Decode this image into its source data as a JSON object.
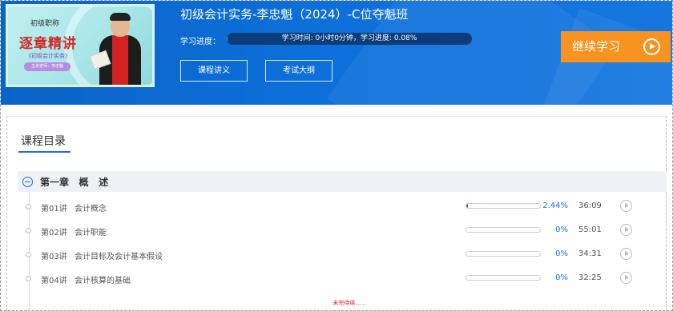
{
  "header": {
    "course_title": "初级会计实务-李忠魁（2024）-C位夺魁班",
    "progress_label": "学习进度：",
    "progress_text": "学习时间: 0小时0分钟，学习进度: 0.08%",
    "progress_fraction": 0.0008,
    "buttons": {
      "handout": "课程讲义",
      "syllabus": "考试大纲"
    },
    "continue_label": "继续学习",
    "thumbnail": {
      "level": "初级职称",
      "title": "逐章精讲",
      "subtitle": "《初级会计实务》",
      "tag": "主讲老师：李忠魁"
    }
  },
  "catalog": {
    "title": "课程目录",
    "chapter": {
      "title": "第一章   概   述"
    },
    "lessons": [
      {
        "num": "第01讲",
        "name": "会计概念",
        "percent": "2.44%",
        "progress": 0.0244,
        "duration": "36:09"
      },
      {
        "num": "第02讲",
        "name": "会计职能",
        "percent": "0%",
        "progress": 0,
        "duration": "55:01"
      },
      {
        "num": "第03讲",
        "name": "会计目标及会计基本假设",
        "percent": "0%",
        "progress": 0,
        "duration": "34:31"
      },
      {
        "num": "第04讲",
        "name": "会计核算的基础",
        "percent": "0%",
        "progress": 0,
        "duration": "32:25"
      }
    ],
    "footer_note": "未完待续......"
  },
  "colors": {
    "header_blue": "#0d6fd9",
    "accent_orange": "#f7931e",
    "link_blue": "#1b74d9",
    "note_red": "#e02020"
  }
}
